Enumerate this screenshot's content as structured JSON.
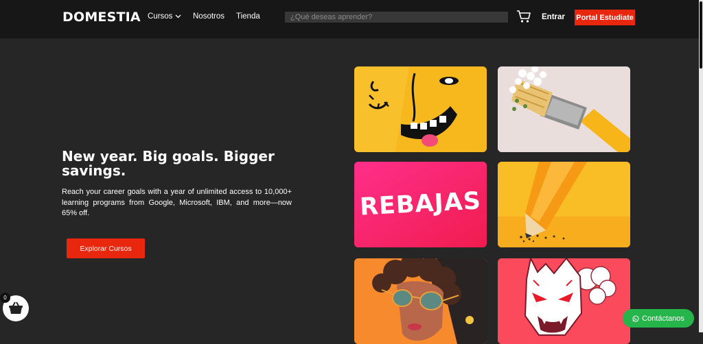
{
  "header": {
    "logo": "DOMESTIA",
    "nav": [
      {
        "label": "Cursos",
        "has_dropdown": true
      },
      {
        "label": "Nosotros"
      },
      {
        "label": "Tienda"
      }
    ],
    "search_placeholder": "¿Qué deseas aprender?",
    "login_label": "Entrar",
    "portal_label": "Portal Estudiate"
  },
  "hero": {
    "title": "New year. Big goals. Bigger savings.",
    "description": "Reach your career goals with a year of unlimited access to 10,000+ learning programs from Google, Microsoft, IBM, and more—now 65% off.",
    "cta_label": "Explorar Cursos"
  },
  "gallery": {
    "sale_tile_text": "REBAJAS"
  },
  "floating": {
    "cart_count": "0",
    "contact_label": "Contáctanos"
  },
  "colors": {
    "accent": "#e8270e",
    "background": "#262626",
    "navbar": "#171717",
    "whatsapp": "#25b54a"
  }
}
